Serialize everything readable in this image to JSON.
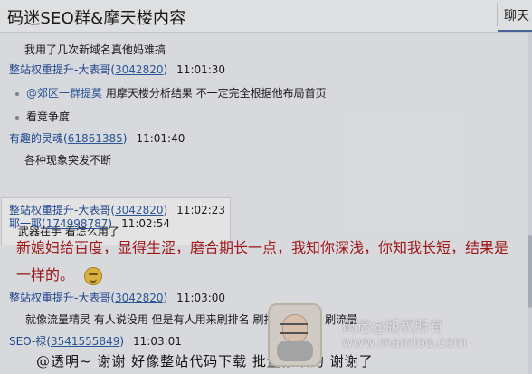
{
  "header": {
    "title": "码迷SEO群&摩天楼内容",
    "tab_label": "聊天"
  },
  "messages": [
    {
      "kind": "text",
      "text": "我用了几次新域名真他妈难搞"
    },
    {
      "kind": "sender",
      "name": "整站权重提升-大表哥",
      "qq": "3042820",
      "time": "11:01:30"
    },
    {
      "kind": "bullet_mention",
      "mention": "@郊区一群提莫",
      "text": "用摩天楼分析结果 不一定完全根据他布局首页"
    },
    {
      "kind": "bullet",
      "text": "看竞争度"
    },
    {
      "kind": "sender",
      "name": "有趣的灵魂",
      "qq": "61861385",
      "time": "11:01:40"
    },
    {
      "kind": "text",
      "text": "各种现象突发不断"
    },
    {
      "kind": "sender",
      "name": "整站权重提升-大表哥",
      "qq": "3042820",
      "time": "11:02:23"
    },
    {
      "kind": "text",
      "text": "武器在手 看怎么用了"
    },
    {
      "kind": "sender",
      "name": "耶一耶",
      "qq": "174998787",
      "time": "11:02:54"
    },
    {
      "kind": "big",
      "text": "新媳妇给百度，显得生涩，磨合期长一点，我知你深浅，你知我长短，结果是"
    },
    {
      "kind": "big",
      "text": "一样的。"
    },
    {
      "kind": "sender",
      "name": "整站权重提升-大表哥",
      "qq": "3042820",
      "time": "11:03:00"
    },
    {
      "kind": "text",
      "text": "就像流量精灵 有人说没用 但是有人用来刷排名 刷指数 对手站 刷流量"
    },
    {
      "kind": "sender",
      "name": "SEO-禄",
      "qq": "3541555849",
      "time": "11:03:01"
    },
    {
      "kind": "big2",
      "text": "@透明~  谢谢    好像整站代码下载   批量修改的      谢谢了"
    }
  ],
  "watermark": {
    "line1": "码迷@版权所有",
    "line2": "www.mamioo.com"
  }
}
